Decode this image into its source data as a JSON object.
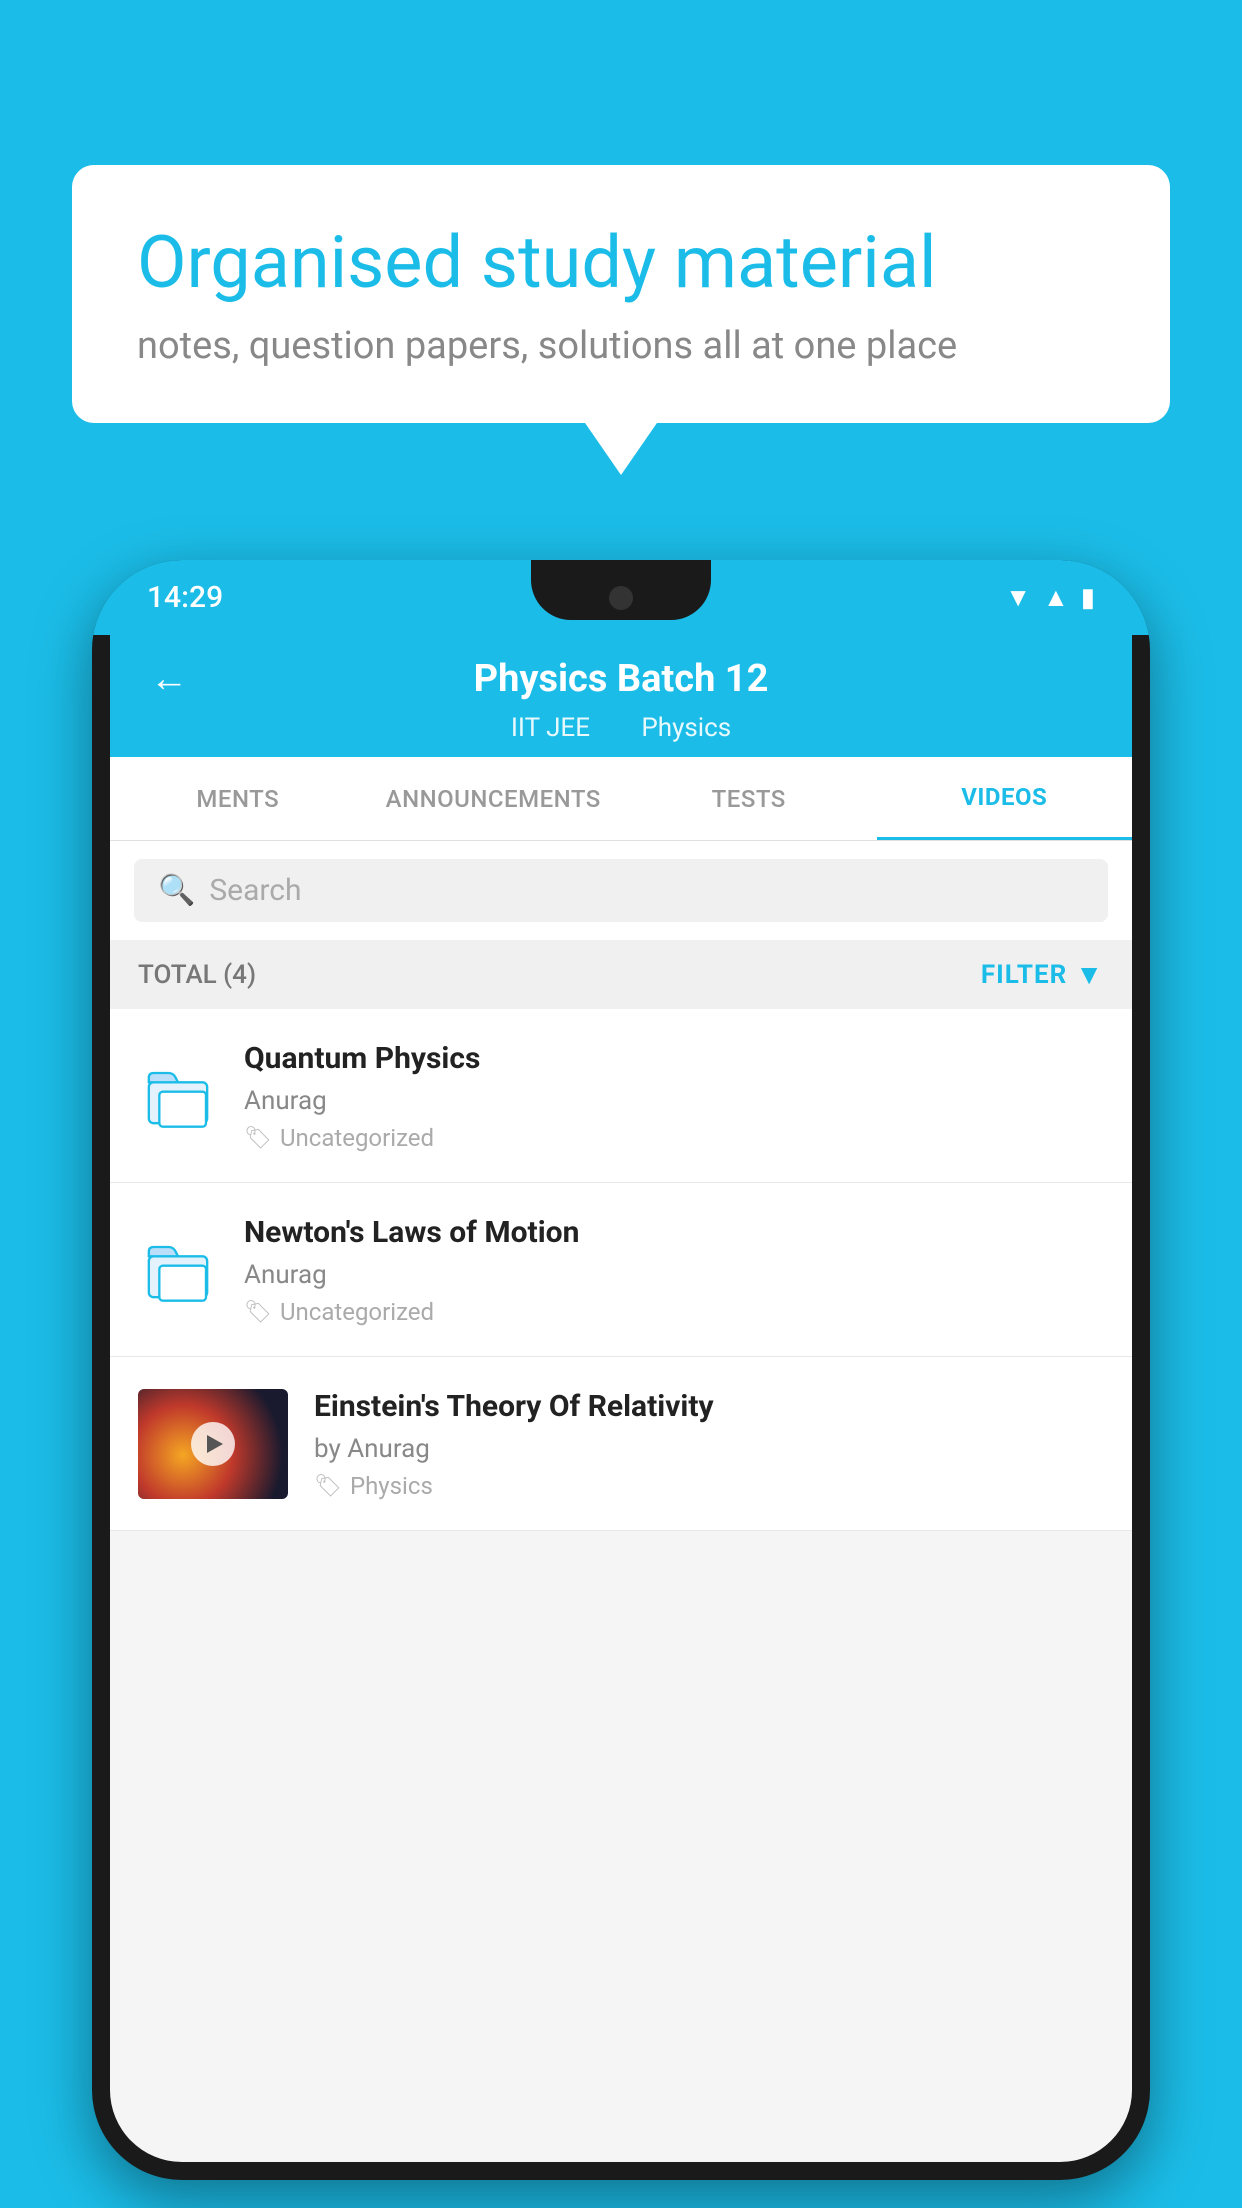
{
  "background_color": "#1BBDE8",
  "speech_bubble": {
    "title": "Organised study material",
    "subtitle": "notes, question papers, solutions all at one place"
  },
  "phone": {
    "status_bar": {
      "time": "14:29",
      "icons": [
        "wifi",
        "signal",
        "battery"
      ]
    },
    "header": {
      "back_label": "←",
      "title": "Physics Batch 12",
      "subtitle_left": "IIT JEE",
      "subtitle_right": "Physics"
    },
    "tabs": [
      {
        "label": "MENTS",
        "active": false
      },
      {
        "label": "ANNOUNCEMENTS",
        "active": false
      },
      {
        "label": "TESTS",
        "active": false
      },
      {
        "label": "VIDEOS",
        "active": true
      }
    ],
    "search": {
      "placeholder": "Search"
    },
    "filter_bar": {
      "total_label": "TOTAL (4)",
      "filter_label": "FILTER"
    },
    "videos": [
      {
        "title": "Quantum Physics",
        "author": "Anurag",
        "tag": "Uncategorized",
        "type": "folder",
        "has_thumbnail": false
      },
      {
        "title": "Newton's Laws of Motion",
        "author": "Anurag",
        "tag": "Uncategorized",
        "type": "folder",
        "has_thumbnail": false
      },
      {
        "title": "Einstein's Theory Of Relativity",
        "author": "by Anurag",
        "tag": "Physics",
        "type": "video",
        "has_thumbnail": true
      }
    ]
  }
}
